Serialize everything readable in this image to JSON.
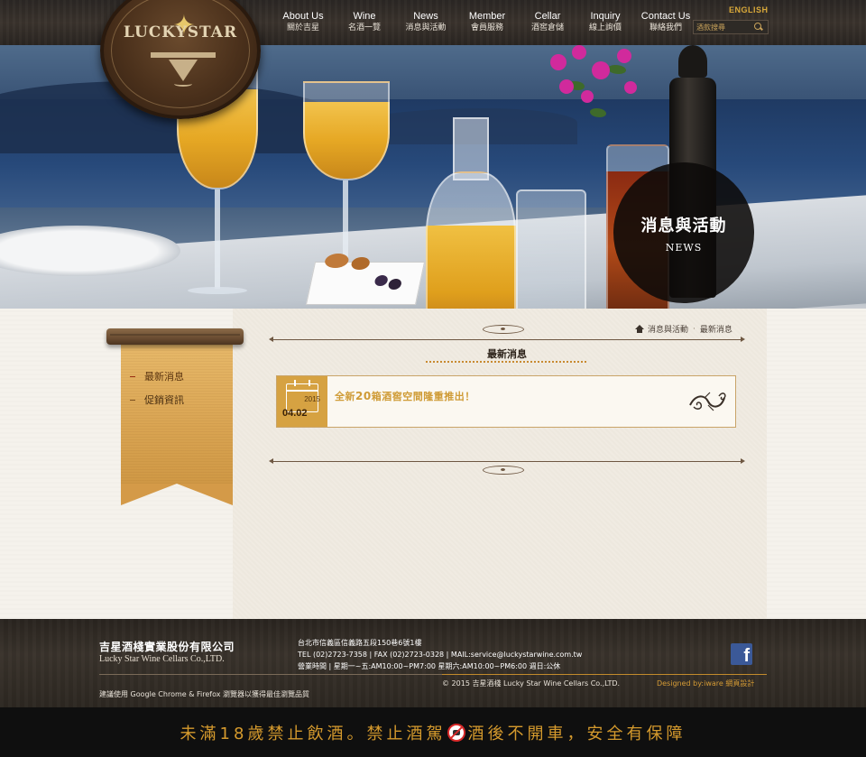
{
  "header": {
    "logo_text": "LUCKYSTAR",
    "language_link": "ENGLISH",
    "search_placeholder": "酒款搜尋",
    "nav": [
      {
        "en": "About Us",
        "zh": "關於吉星"
      },
      {
        "en": "Wine",
        "zh": "名酒一覽"
      },
      {
        "en": "News",
        "zh": "消息與活動"
      },
      {
        "en": "Member",
        "zh": "會員服務"
      },
      {
        "en": "Cellar",
        "zh": "酒窖倉儲"
      },
      {
        "en": "Inquiry",
        "zh": "線上詢價"
      },
      {
        "en": "Contact Us",
        "zh": "聯絡我們"
      }
    ]
  },
  "hero": {
    "title_zh": "消息與活動",
    "title_en": "NEWS"
  },
  "sidebar": {
    "items": [
      {
        "label": "最新消息",
        "active": true
      },
      {
        "label": "促銷資訊",
        "active": false
      }
    ]
  },
  "breadcrumb": {
    "items": [
      "消息與活動",
      "最新消息"
    ]
  },
  "main": {
    "section_title": "最新消息",
    "news": [
      {
        "year": "2015",
        "date": "04.02",
        "title_pre": "全新",
        "title_num": "20",
        "title_post": "箱酒窖空間隆重推出！"
      }
    ]
  },
  "footer": {
    "company_zh": "吉星酒棧實業股份有限公司",
    "company_en": "Lucky Star Wine Cellars Co.,LTD.",
    "address": "台北市信義區信義路五段150巷6號1樓",
    "contact": "TEL (02)2723-7358 | FAX (02)2723-0328 | MAIL:service@luckystarwine.com.tw",
    "hours": "營業時間 | 星期一~五:AM10:00~PM7:00    星期六:AM10:00~PM6:00    週日:公休",
    "copyright": "© 2015 吉星酒棧 Lucky Star Wine Cellars Co.,LTD.",
    "designed_by": "Designed by:iware 網頁設計",
    "browser_note": "建議使用 Google Chrome & Firefox 瀏覽器以獲得最佳瀏覽品質",
    "facebook_letter": "f"
  },
  "warning": {
    "part1": "未滿18歲禁止飲酒。禁止酒駕",
    "part2": "酒後不開車，安全有保障"
  },
  "colors": {
    "accent_gold": "#d59a2d",
    "dark_wood": "#2b2724",
    "news_date_bg": "#d6a242",
    "facebook_blue": "#3b5998"
  }
}
